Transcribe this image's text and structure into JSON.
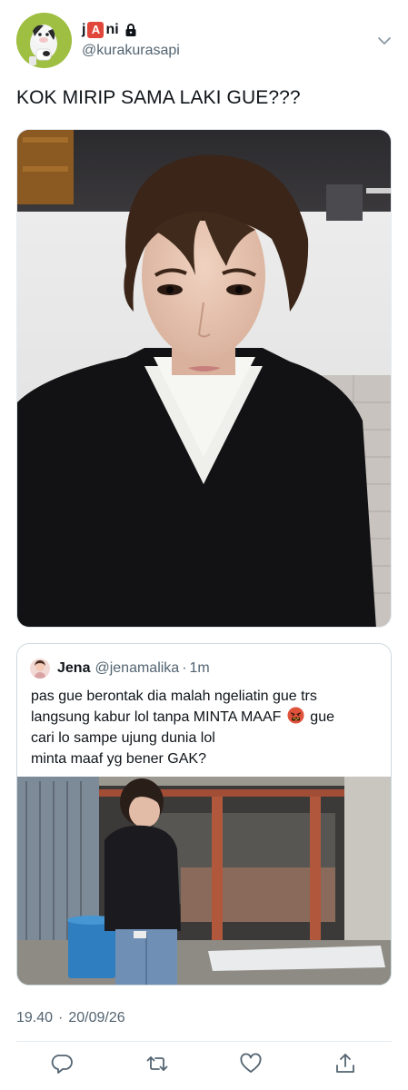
{
  "user": {
    "display_name_prefix": "j",
    "display_name_badge": "A",
    "display_name_suffix": "ni",
    "handle": "@kurakurasapi",
    "avatar_icon": "cow-figure-avatar",
    "protected_icon": "lock-icon"
  },
  "tweet": {
    "text": "KOK MIRIP SAMA LAKI GUE???",
    "timestamp_time": "19.40",
    "timestamp_sep": "·",
    "timestamp_date": "20/09/26"
  },
  "quote": {
    "name": "Jena",
    "handle": "@jenamalika",
    "dot": "·",
    "time": "1m",
    "lines": [
      "pas gue berontak dia malah ngeliatin gue trs",
      "langsung kabur lol tanpa MINTA MAAF",
      "gue",
      "cari lo sampe ujung dunia lol",
      "minta maaf yg bener GAK?"
    ],
    "emoji": "angry-cursing-face"
  },
  "actions": {
    "icons": [
      "reply-icon",
      "retweet-icon",
      "like-icon",
      "share-icon"
    ]
  },
  "colors": {
    "text": "#0f1419",
    "secondary": "#536471",
    "border": "#cfd9de",
    "badge": "#e0473a"
  }
}
